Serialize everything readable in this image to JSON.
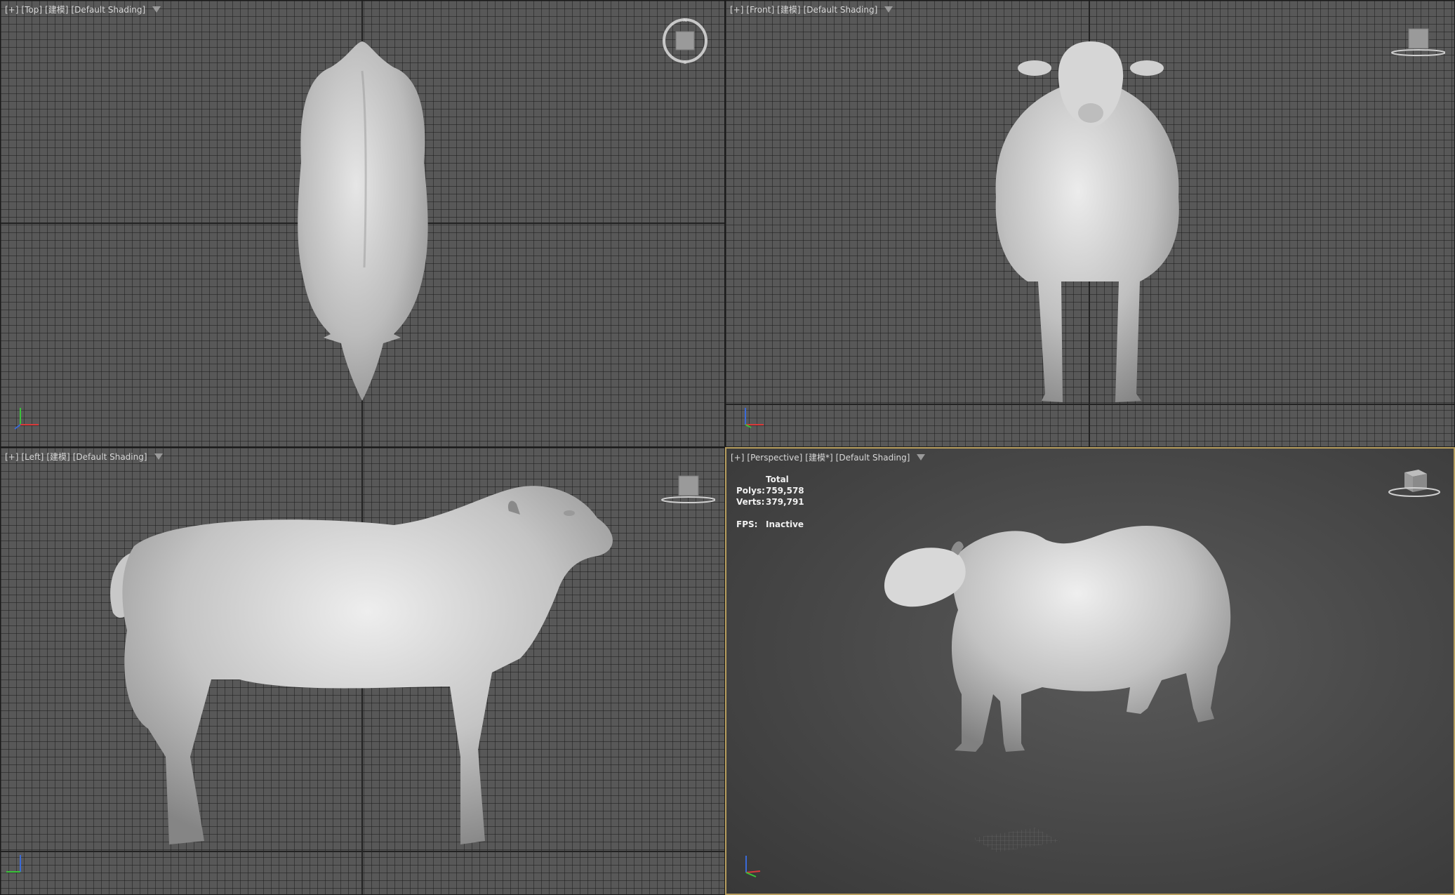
{
  "viewports": {
    "top": {
      "plus": "[+]",
      "view": "[Top]",
      "mode": "[建模]",
      "shading": "[Default Shading]"
    },
    "front": {
      "plus": "[+]",
      "view": "[Front]",
      "mode": "[建模]",
      "shading": "[Default Shading]"
    },
    "left": {
      "plus": "[+]",
      "view": "[Left]",
      "mode": "[建模]",
      "shading": "[Default Shading]"
    },
    "persp": {
      "plus": "[+]",
      "view": "[Perspective]",
      "mode": "[建模*]",
      "shading": "[Default Shading]"
    }
  },
  "stats": {
    "total_label": "Total",
    "polys_label": "Polys:",
    "polys_value": "759,578",
    "verts_label": "Verts:",
    "verts_value": "379,791",
    "fps_label": "FPS:",
    "fps_value": "Inactive"
  },
  "colors": {
    "active_border": "#b9a060",
    "grid_bg": "#585858",
    "model": "#c8c8c8"
  },
  "icons": [
    "filter-icon",
    "viewcube-icon",
    "compass-icon",
    "axis-tripod-icon"
  ]
}
